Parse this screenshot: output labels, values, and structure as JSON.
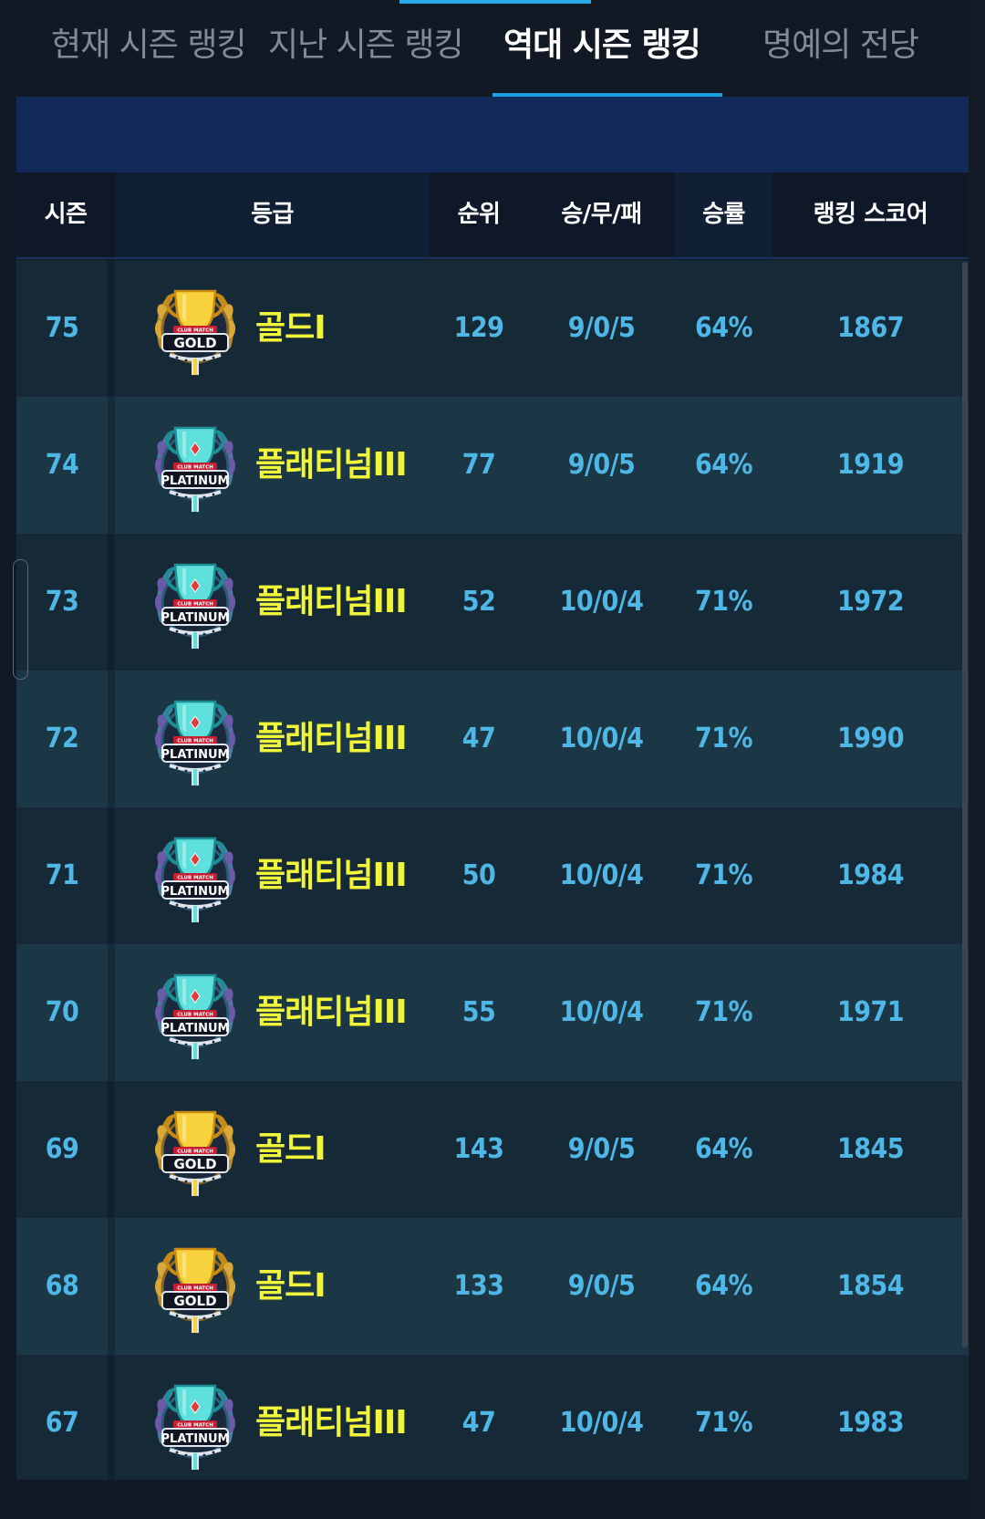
{
  "tabs": [
    {
      "label": "현재 시즌 랭킹",
      "active": false
    },
    {
      "label": "지난 시즌 랭킹",
      "active": false
    },
    {
      "label": "역대 시즌 랭킹",
      "active": true
    },
    {
      "label": "명예의 전당",
      "active": false
    }
  ],
  "table": {
    "headers": {
      "season": "시즌",
      "grade": "등급",
      "rank": "순위",
      "record": "승/무/패",
      "win_rate": "승률",
      "score": "랭킹 스코어"
    },
    "rows": [
      {
        "season": "75",
        "badge": "gold-badge-icon",
        "grade": "골드I",
        "rank": "129",
        "record": "9/0/5",
        "win_rate": "64%",
        "score": "1867"
      },
      {
        "season": "74",
        "badge": "platinum-badge-icon",
        "grade": "플래티넘III",
        "rank": "77",
        "record": "9/0/5",
        "win_rate": "64%",
        "score": "1919"
      },
      {
        "season": "73",
        "badge": "platinum-badge-icon",
        "grade": "플래티넘III",
        "rank": "52",
        "record": "10/0/4",
        "win_rate": "71%",
        "score": "1972"
      },
      {
        "season": "72",
        "badge": "platinum-badge-icon",
        "grade": "플래티넘III",
        "rank": "47",
        "record": "10/0/4",
        "win_rate": "71%",
        "score": "1990"
      },
      {
        "season": "71",
        "badge": "platinum-badge-icon",
        "grade": "플래티넘III",
        "rank": "50",
        "record": "10/0/4",
        "win_rate": "71%",
        "score": "1984"
      },
      {
        "season": "70",
        "badge": "platinum-badge-icon",
        "grade": "플래티넘III",
        "rank": "55",
        "record": "10/0/4",
        "win_rate": "71%",
        "score": "1971"
      },
      {
        "season": "69",
        "badge": "gold-badge-icon",
        "grade": "골드I",
        "rank": "143",
        "record": "9/0/5",
        "win_rate": "64%",
        "score": "1845"
      },
      {
        "season": "68",
        "badge": "gold-badge-icon",
        "grade": "골드I",
        "rank": "133",
        "record": "9/0/5",
        "win_rate": "64%",
        "score": "1854"
      },
      {
        "season": "67",
        "badge": "platinum-badge-icon",
        "grade": "플래티넘III",
        "rank": "47",
        "record": "10/0/4",
        "win_rate": "71%",
        "score": "1983"
      }
    ]
  },
  "badges": {
    "gold": {
      "text": "GOLD",
      "ribbon_text": "CLUB MATCH"
    },
    "platinum": {
      "text": "PLATINUM",
      "ribbon_text": "CLUB MATCH"
    }
  },
  "colors": {
    "accent": "#1ea1e3",
    "number_text": "#4fb7e6",
    "grade_text": "#f1f53a",
    "banner": "#112a5a"
  }
}
